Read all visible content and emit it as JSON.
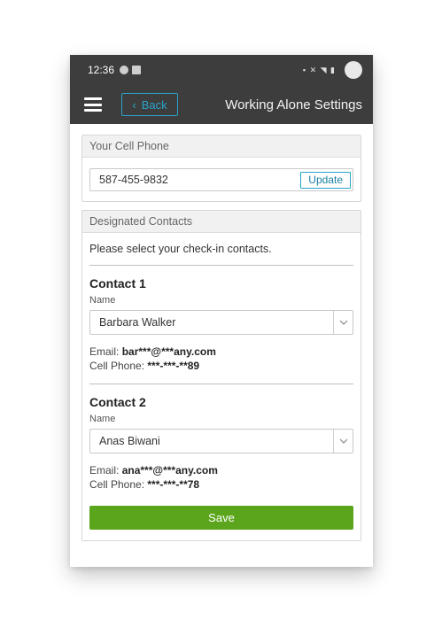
{
  "status_bar": {
    "time": "12:36",
    "system_icons": [
      "alarm-icon",
      "mute-icon",
      "wifi-icon",
      "signal-icon",
      "battery-icon"
    ]
  },
  "app_bar": {
    "back_label": "Back",
    "title": "Working Alone Settings"
  },
  "cell_phone": {
    "header": "Your Cell Phone",
    "value": "587-455-9832",
    "update_label": "Update"
  },
  "designated_contacts": {
    "header": "Designated Contacts",
    "instruction": "Please select your check-in contacts.",
    "contacts": [
      {
        "title": "Contact 1",
        "name_label": "Name",
        "name": "Barbara Walker",
        "email_label": "Email:",
        "email": "bar***@***any.com",
        "phone_label": "Cell Phone:",
        "phone": "***-***-**89"
      },
      {
        "title": "Contact 2",
        "name_label": "Name",
        "name": "Anas Biwani",
        "email_label": "Email:",
        "email": "ana***@***any.com",
        "phone_label": "Cell Phone:",
        "phone": "***-***-**78"
      }
    ],
    "save_label": "Save"
  },
  "colors": {
    "appbar": "#3d3d3d",
    "accent": "#29a3c9",
    "save": "#5aa51b"
  }
}
